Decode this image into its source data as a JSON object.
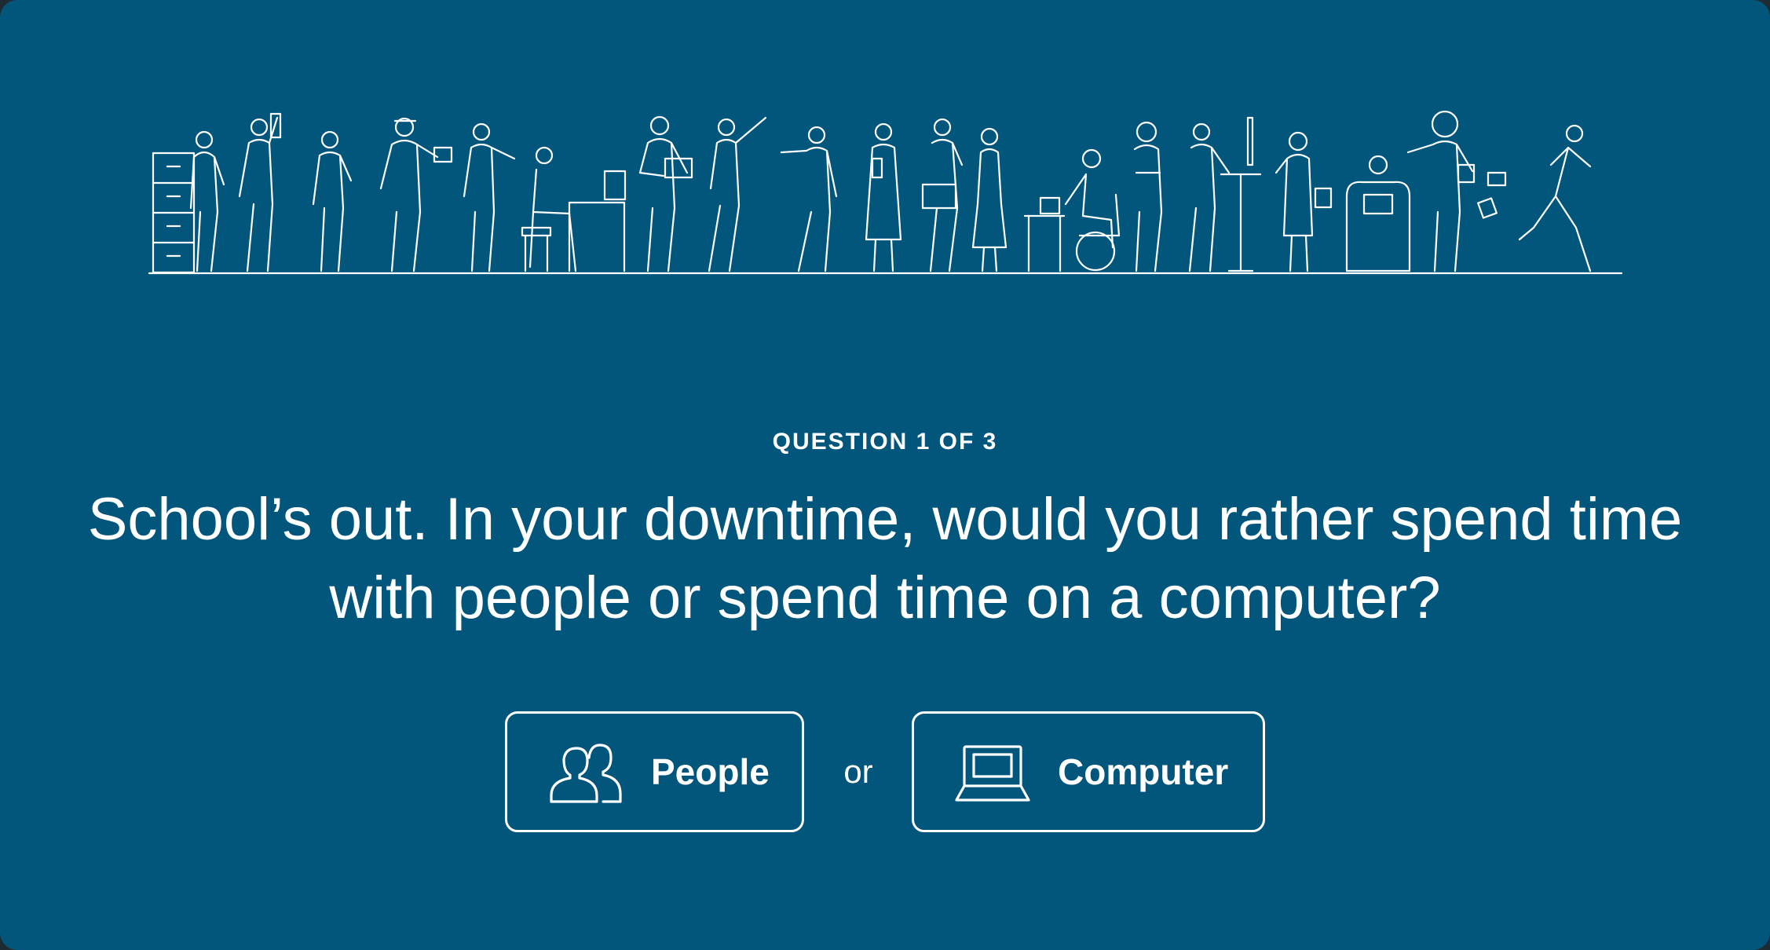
{
  "quiz": {
    "progress_label": "QUESTION 1 OF 3",
    "question_text": "School’s out. In your downtime, would you rather spend time with people or spend time on a computer?",
    "separator": "or",
    "options": [
      {
        "label": "People",
        "icon": "people-icon"
      },
      {
        "label": "Computer",
        "icon": "laptop-icon"
      }
    ]
  },
  "illustration": {
    "icon": "workers-lineup-illustration",
    "stroke_color": "#ffffff"
  },
  "colors": {
    "background": "#02567c",
    "foreground": "#ffffff"
  }
}
